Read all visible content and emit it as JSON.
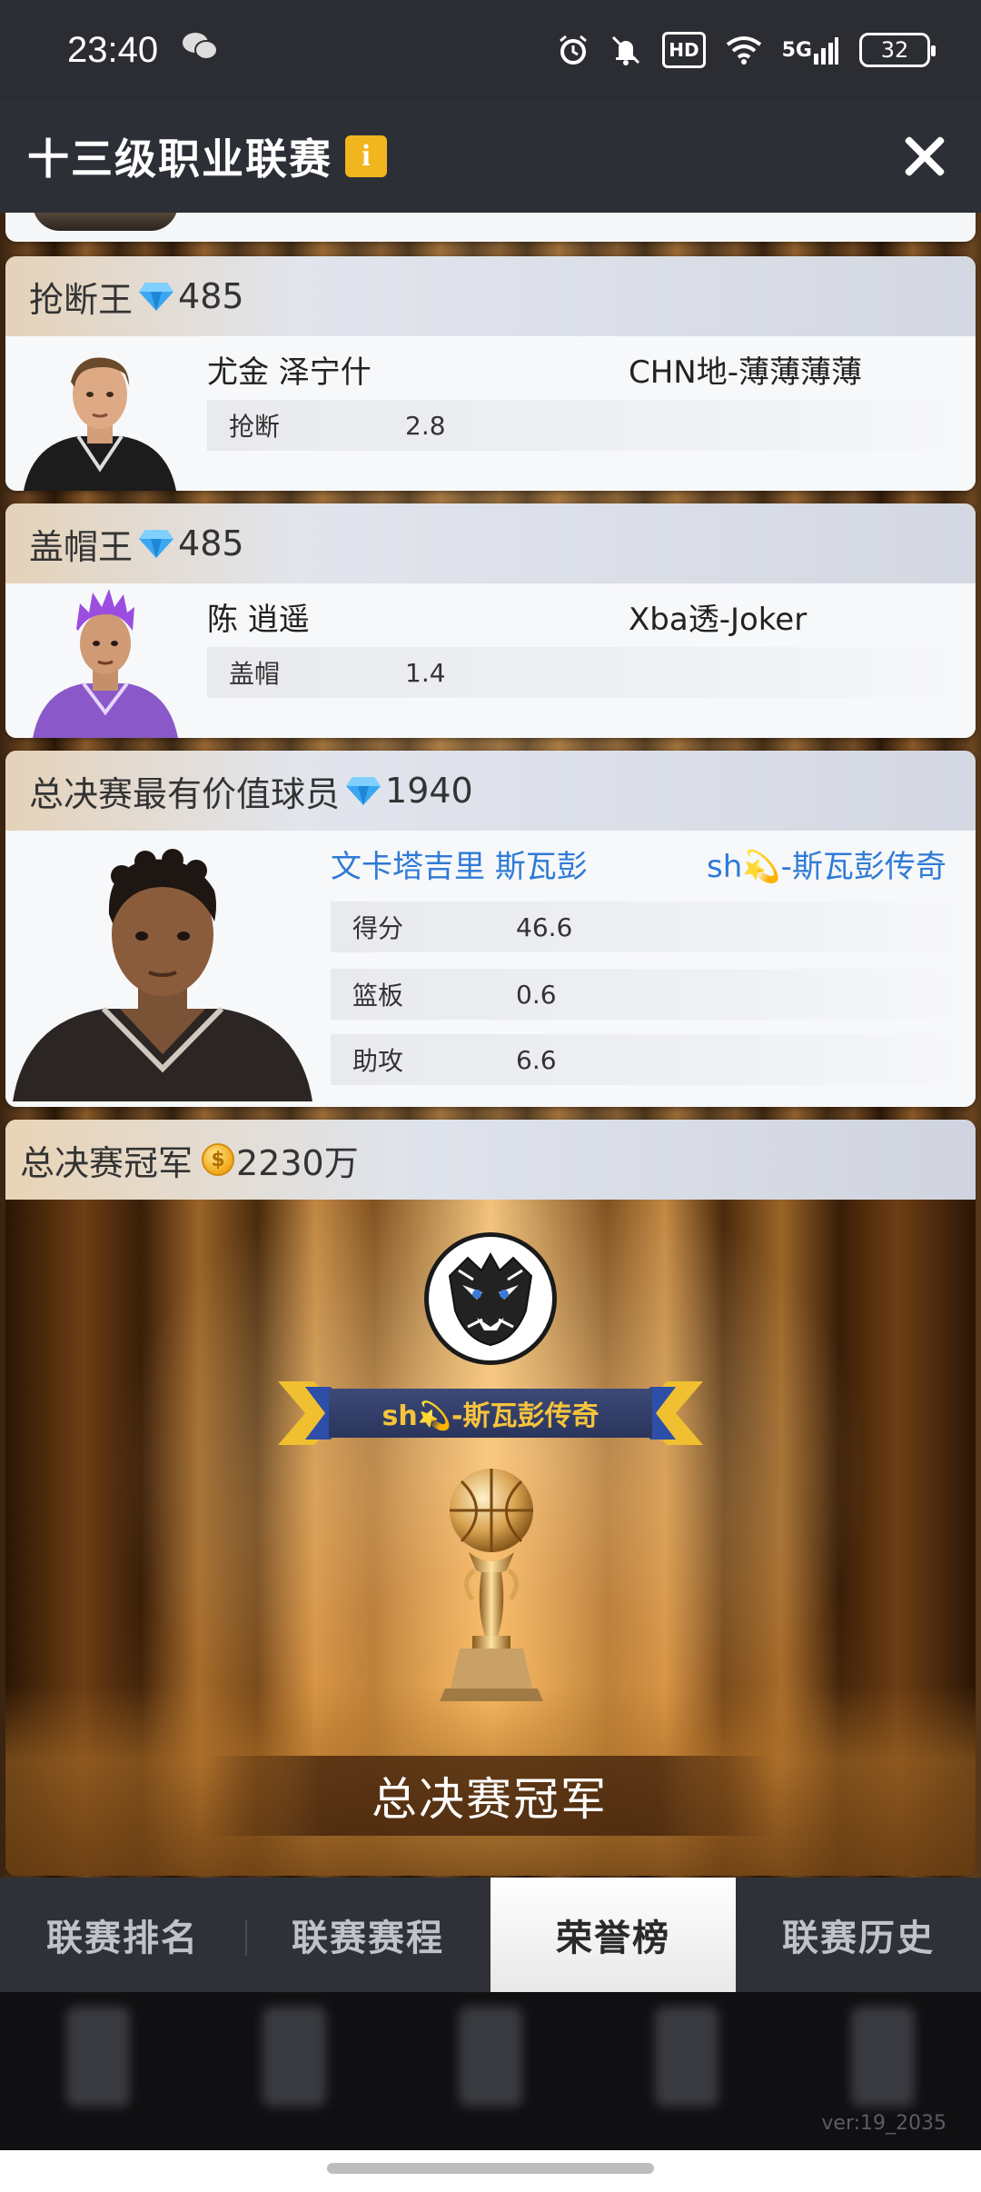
{
  "status_bar": {
    "time": "23:40",
    "hd_label": "HD",
    "network_label": "5G",
    "battery": "32"
  },
  "header": {
    "title": "十三级职业联赛",
    "info_icon": "i"
  },
  "awards": {
    "steals": {
      "title": "抢断王",
      "reward": "485",
      "player": "尤金 泽宁什",
      "team": "CHN地-薄薄薄薄",
      "stats": [
        {
          "label": "抢断",
          "value": "2.8"
        }
      ]
    },
    "blocks": {
      "title": "盖帽王",
      "reward": "485",
      "player": "陈 逍遥",
      "team": "Xba透-Joker",
      "stats": [
        {
          "label": "盖帽",
          "value": "1.4"
        }
      ]
    },
    "finals_mvp": {
      "title": "总决赛最有价值球员",
      "reward": "1940",
      "player": "文卡塔吉里 斯瓦彭",
      "team": "sh💫-斯瓦彭传奇",
      "stats": [
        {
          "label": "得分",
          "value": "46.6"
        },
        {
          "label": "篮板",
          "value": "0.6"
        },
        {
          "label": "助攻",
          "value": "6.6"
        }
      ]
    },
    "champion": {
      "title": "总决赛冠军",
      "reward": "2230万",
      "team": "sh💫-斯瓦彭传奇",
      "caption": "总决赛冠军"
    }
  },
  "tabs": [
    {
      "label": "联赛排名",
      "active": false
    },
    {
      "label": "联赛赛程",
      "active": false
    },
    {
      "label": "荣誉榜",
      "active": true
    },
    {
      "label": "联赛历史",
      "active": false
    }
  ],
  "version": "ver:19_2035",
  "colors": {
    "accent_blue": "#2f7ad6",
    "info_badge": "#f1b61e",
    "ribbon_text": "#f6c43c"
  }
}
